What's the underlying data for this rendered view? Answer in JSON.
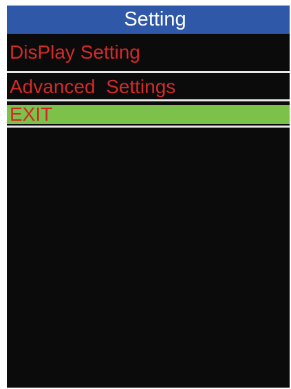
{
  "header": {
    "title": "Setting"
  },
  "menu": {
    "items": [
      {
        "label": "DisPlay Setting"
      },
      {
        "label": "Advanced  Settings"
      },
      {
        "label": "EXIT",
        "selected": true
      }
    ]
  },
  "colors": {
    "title_bar": "#2f58a8",
    "title_text": "#ffffff",
    "menu_text": "#d32a2a",
    "selected_bg": "#7cc24a",
    "screen_bg": "#0b0b0b",
    "divider": "#e8e8e8"
  }
}
